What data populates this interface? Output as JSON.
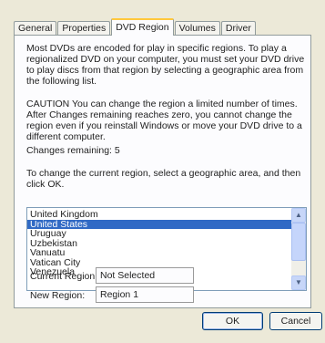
{
  "tabs": [
    {
      "label": "General"
    },
    {
      "label": "Properties"
    },
    {
      "label": "DVD Region"
    },
    {
      "label": "Volumes"
    },
    {
      "label": "Driver"
    }
  ],
  "panel": {
    "intro": "Most DVDs are encoded for play in specific regions. To play a regionalized DVD on your computer, you must set your DVD drive to play discs from that region by selecting a geographic area from the following list.",
    "caution": "CAUTION  You can change the region a limited number of times. After Changes remaining reaches zero, you cannot change the region even if you reinstall Windows or move your DVD drive to a different computer.",
    "changes_remaining": "Changes remaining: 5",
    "instruction": "To change the current region, select a geographic area, and then click OK."
  },
  "region_list": {
    "items": [
      "United Kingdom",
      "United States",
      "Uruguay",
      "Uzbekistan",
      "Vanuatu",
      "Vatican City",
      "Venezuela"
    ],
    "selected": "United States"
  },
  "current_region": {
    "label": "Current Region:",
    "value": "Not Selected"
  },
  "new_region": {
    "label": "New Region:",
    "value": "Region 1"
  },
  "buttons": {
    "ok": "OK",
    "cancel": "Cancel"
  },
  "icons": {
    "scroll_up": "scroll-up-arrow",
    "scroll_down": "scroll-down-arrow"
  }
}
